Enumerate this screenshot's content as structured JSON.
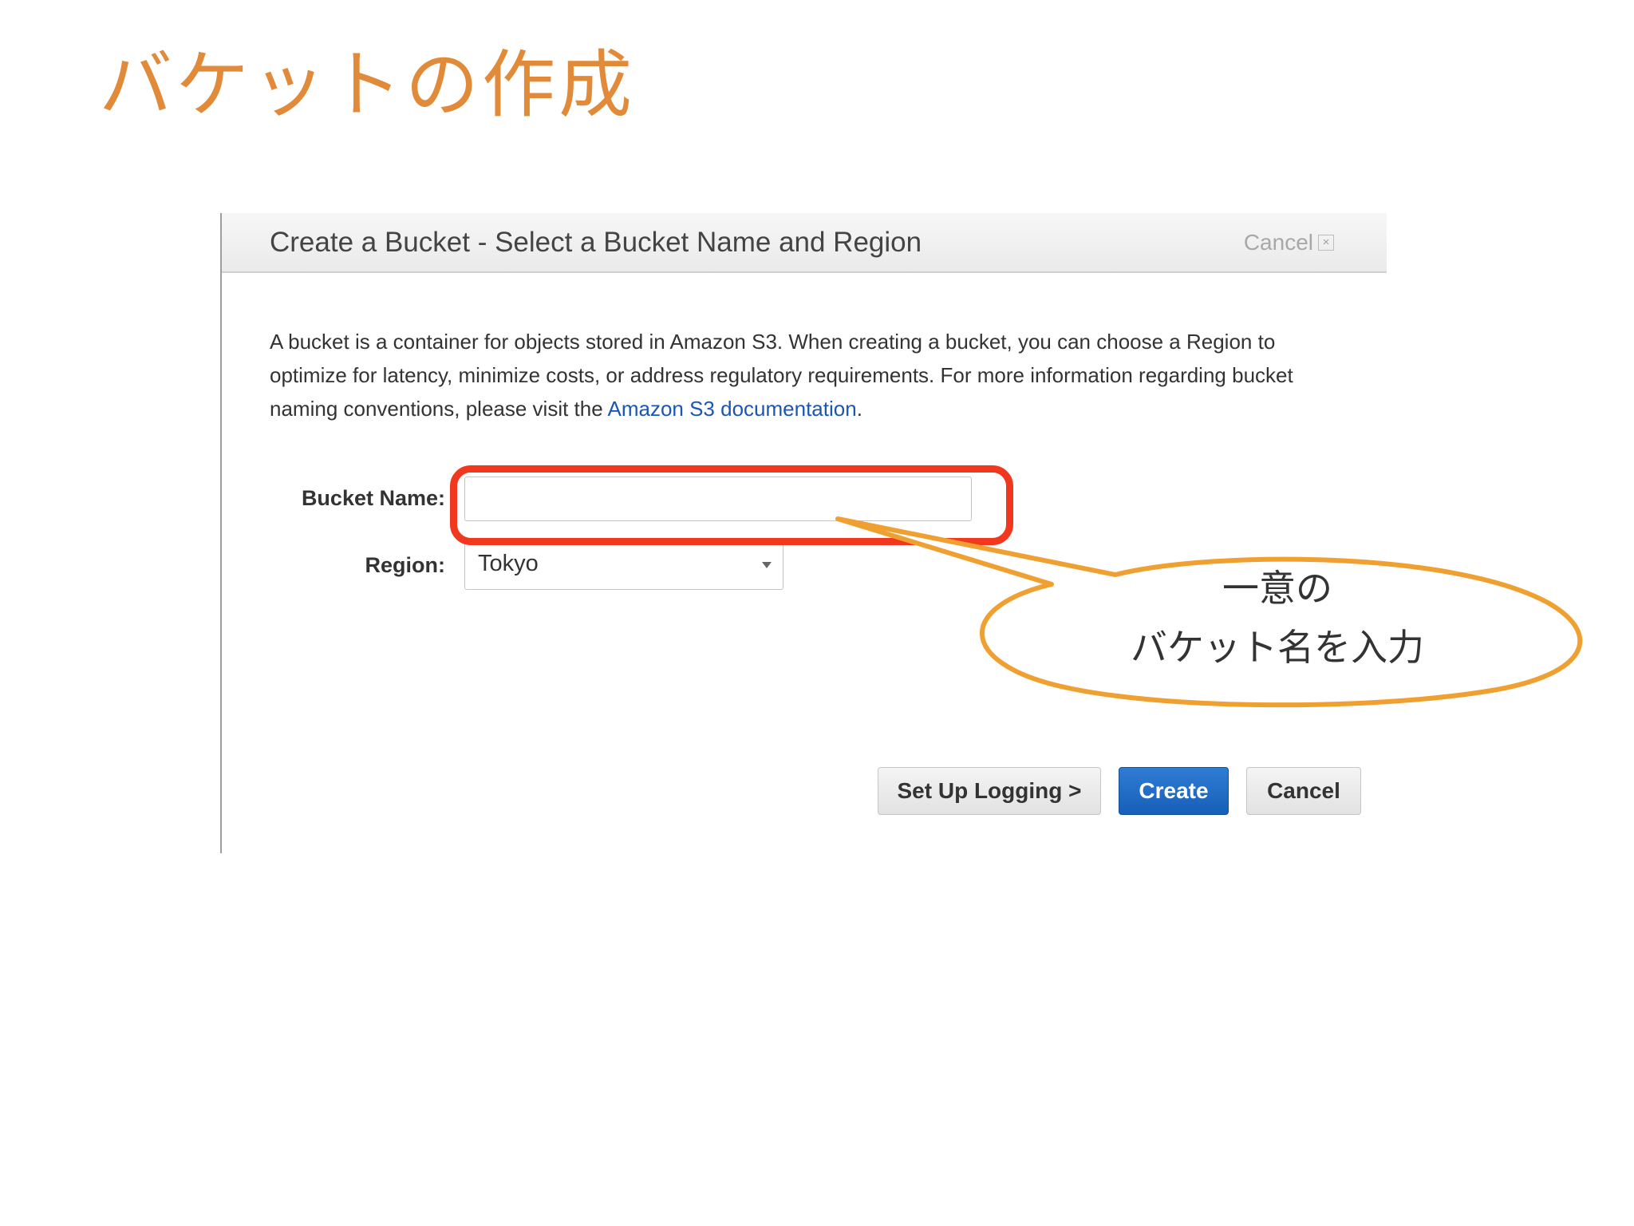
{
  "slide": {
    "title": "バケットの作成"
  },
  "dialog": {
    "title": "Create a Bucket - Select a Bucket Name and Region",
    "header_cancel_label": "Cancel",
    "close_symbol": "×",
    "description_text": "A bucket is a container for objects stored in Amazon S3. When creating a bucket, you can choose a Region to optimize for latency, minimize costs, or address regulatory requirements. For more information regarding bucket naming conventions, please visit the ",
    "description_link": "Amazon S3 documentation",
    "description_end": ".",
    "bucket_name_label": "Bucket Name:",
    "bucket_name_value": "",
    "region_label": "Region:",
    "region_value": "Tokyo",
    "buttons": {
      "setup_logging": "Set Up Logging >",
      "create": "Create",
      "cancel": "Cancel"
    }
  },
  "callout": {
    "line1": "一意の",
    "line2": "バケット名を入力"
  },
  "colors": {
    "title": "#e08a3a",
    "highlight": "#f2371f",
    "callout_border": "#f0a030",
    "create_button": "#1f6cc6",
    "link": "#1a56b5"
  },
  "icons": {
    "close": "close-icon",
    "dropdown": "select-arrow-icon"
  }
}
